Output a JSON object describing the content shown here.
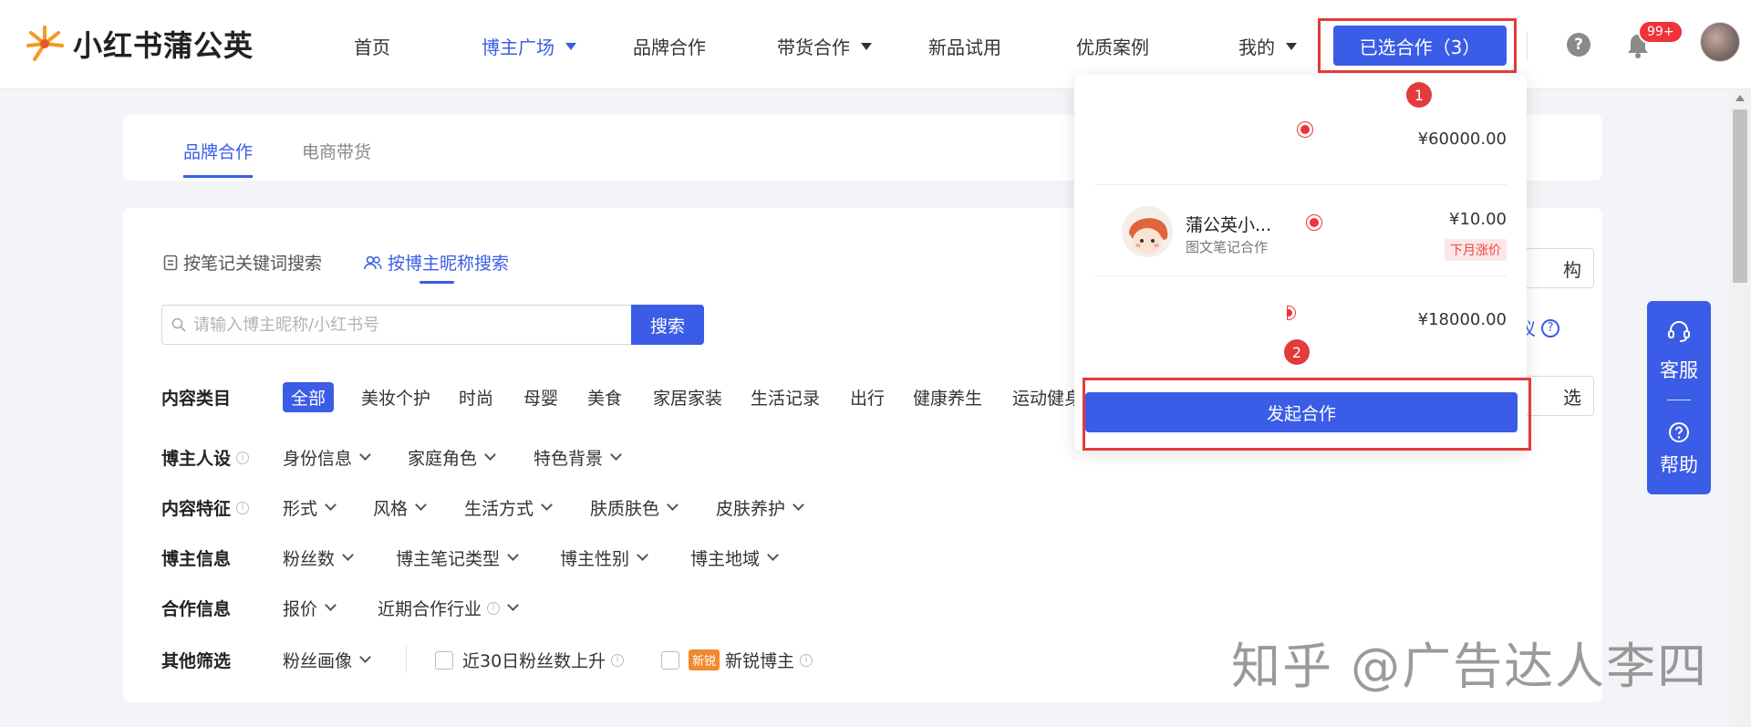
{
  "header": {
    "logo_text": "小红书蒲公英",
    "nav": [
      {
        "label": "首页"
      },
      {
        "label": "博主广场"
      },
      {
        "label": "品牌合作"
      },
      {
        "label": "带货合作"
      },
      {
        "label": "新品试用"
      },
      {
        "label": "优质案例"
      },
      {
        "label": "我的"
      }
    ],
    "selected_button": "已选合作（3）",
    "notification_badge": "99+",
    "help_glyph": "?"
  },
  "annotations": {
    "marker_1": "1",
    "marker_2": "2"
  },
  "tabs": [
    {
      "label": "品牌合作"
    },
    {
      "label": "电商带货"
    }
  ],
  "search": {
    "modes": [
      {
        "label": "按笔记关键词搜索"
      },
      {
        "label": "按博主昵称搜索"
      }
    ],
    "placeholder": "请输入博主昵称/小红书号",
    "button": "搜索"
  },
  "filters": {
    "content_category": {
      "label": "内容类目",
      "options": [
        "全部",
        "美妆个护",
        "时尚",
        "母婴",
        "美食",
        "家居家装",
        "生活记录",
        "出行",
        "健康养生",
        "运动健身"
      ]
    },
    "persona": {
      "label": "博主人设",
      "options": [
        "身份信息",
        "家庭角色",
        "特色背景"
      ]
    },
    "content_features": {
      "label": "内容特征",
      "options": [
        "形式",
        "风格",
        "生活方式",
        "肤质肤色",
        "皮肤养护"
      ]
    },
    "creator_info": {
      "label": "博主信息",
      "options": [
        "粉丝数",
        "博主笔记类型",
        "博主性别",
        "博主地域"
      ]
    },
    "cooperation_info": {
      "label": "合作信息",
      "options": [
        "报价",
        "近期合作行业"
      ]
    },
    "other": {
      "label": "其他筛选",
      "dropdown": "粉丝画像",
      "check1": "近30日粉丝数上升",
      "new_tag": "新锐",
      "check2": "新锐博主"
    }
  },
  "right_side": {
    "btn_top": "构",
    "link": "议",
    "btn_bottom": "选"
  },
  "cart": {
    "items": [
      {
        "name": "",
        "type": "",
        "price": "¥60000.00"
      },
      {
        "name": "蒲公英小...",
        "type": "图文笔记合作",
        "price": "¥10.00",
        "tag": "下月涨价"
      },
      {
        "name": "",
        "type": "",
        "price": "¥18000.00"
      }
    ],
    "start_button": "发起合作"
  },
  "service": {
    "service_label": "客服",
    "help_label": "帮助"
  },
  "watermark": "知乎 @广告达人李四",
  "colors": {
    "accent": "#3a5ce6",
    "annotation_red": "#e23b3b",
    "badge_red": "#f0333a",
    "new_tag": "#f08a2c"
  }
}
